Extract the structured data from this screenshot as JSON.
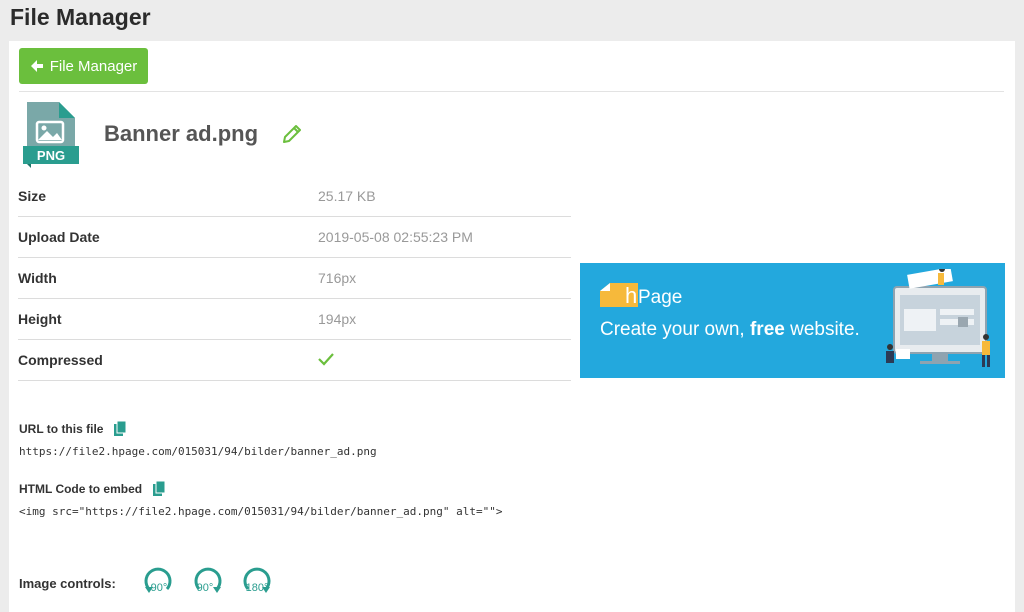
{
  "page": {
    "title": "File Manager"
  },
  "toolbar": {
    "back_label": "File Manager"
  },
  "file": {
    "icon_type": "PNG",
    "name": "Banner ad.png"
  },
  "details": [
    {
      "label": "Size",
      "value": "25.17 KB"
    },
    {
      "label": "Upload Date",
      "value": "2019-05-08 02:55:23 PM"
    },
    {
      "label": "Width",
      "value": "716px"
    },
    {
      "label": "Height",
      "value": "194px"
    },
    {
      "label": "Compressed",
      "value": ""
    }
  ],
  "banner": {
    "logo_text": "Page",
    "logo_letter": "h",
    "tagline_pre": "Create your own, ",
    "tagline_bold": "free",
    "tagline_post": " website."
  },
  "url_section": {
    "label": "URL to this file",
    "value": "https://file2.hpage.com/015031/94/bilder/banner_ad.png"
  },
  "embed_section": {
    "label": "HTML Code to embed",
    "value": "<img src=\"https://file2.hpage.com/015031/94/bilder/banner_ad.png\" alt=\"\">"
  },
  "controls": {
    "label": "Image controls:",
    "rotate_left": "90°",
    "rotate_right": "90°",
    "rotate_180": "180°"
  },
  "colors": {
    "accent_green": "#6bbf3d",
    "teal_icon": "#2a9d8f",
    "banner_blue": "#23a8dd"
  }
}
